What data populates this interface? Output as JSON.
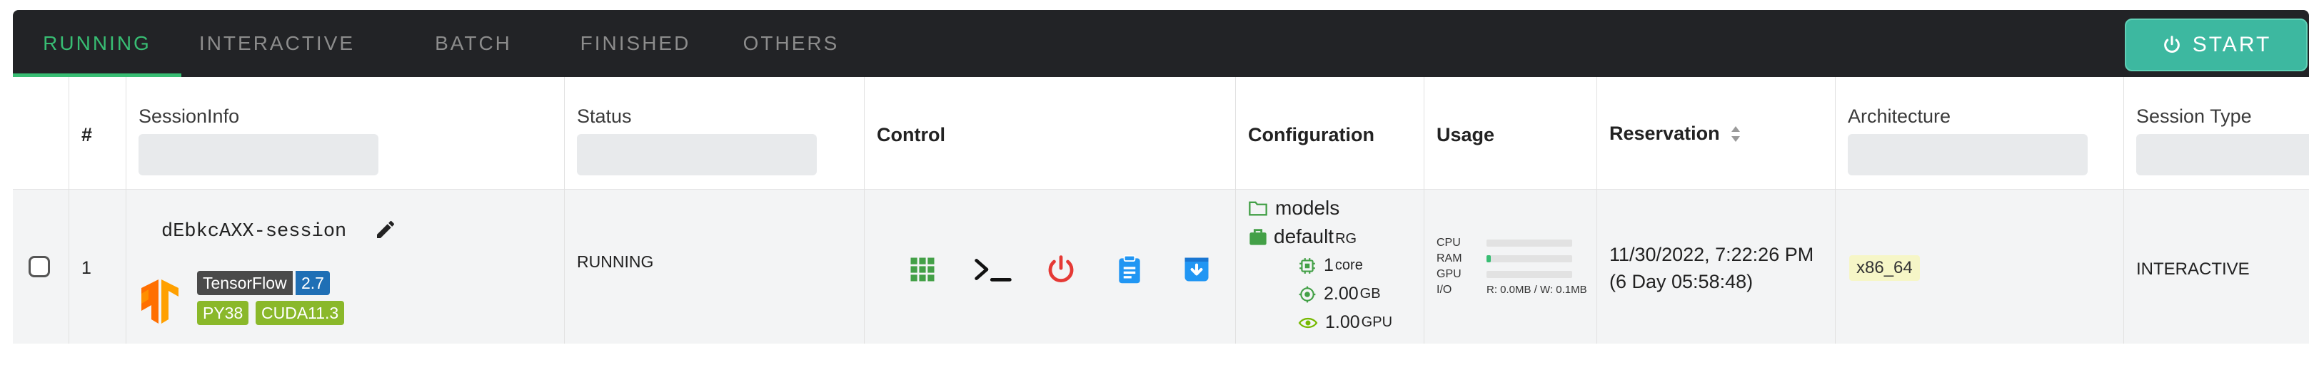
{
  "tabs": [
    {
      "label": "RUNNING",
      "active": true
    },
    {
      "label": "INTERACTIVE",
      "active": false
    },
    {
      "label": "BATCH",
      "active": false
    },
    {
      "label": "FINISHED",
      "active": false
    },
    {
      "label": "OTHERS",
      "active": false
    }
  ],
  "start_button": {
    "label": "START",
    "icon": "power-icon"
  },
  "columns": {
    "index": "#",
    "session_info": "SessionInfo",
    "status": "Status",
    "control": "Control",
    "configuration": "Configuration",
    "usage": "Usage",
    "reservation": "Reservation",
    "architecture": "Architecture",
    "session_type": "Session Type"
  },
  "row": {
    "index": "1",
    "session_name": "dEbkcAXX-session",
    "framework": "TensorFlow",
    "framework_version": "2.7",
    "tags": [
      "PY38",
      "CUDA11.3"
    ],
    "status": "RUNNING",
    "control_icons": [
      "apps-grid-icon",
      "terminal-icon",
      "power-icon",
      "clipboard-icon",
      "download-icon"
    ],
    "config": {
      "folder": "models",
      "group": "default",
      "group_suffix": "RG",
      "cpu_value": "1",
      "cpu_unit": "core",
      "mem_value": "2.00",
      "mem_unit": "GB",
      "gpu_value": "1.00",
      "gpu_unit": "GPU"
    },
    "usage": {
      "cpu_label": "CPU",
      "ram_label": "RAM",
      "gpu_label": "GPU",
      "io_label": "I/O",
      "io_value": "R: 0.0MB / W: 0.1MB",
      "cpu_fraction": 0.0,
      "ram_fraction": 0.05,
      "gpu_fraction": 0.0
    },
    "reservation_time": "11/30/2022, 7:22:26 PM",
    "reservation_duration": "(6 Day 05:58:48)",
    "architecture": "x86_64",
    "session_type": "INTERACTIVE"
  },
  "colors": {
    "accent_green": "#38bd73",
    "start_button": "#3db8a0",
    "header_bg": "#222326",
    "power_red": "#e53935",
    "icon_blue": "#2196f3",
    "tensorflow_orange": "#ff7a1a",
    "tag_green": "#8ab82a"
  }
}
